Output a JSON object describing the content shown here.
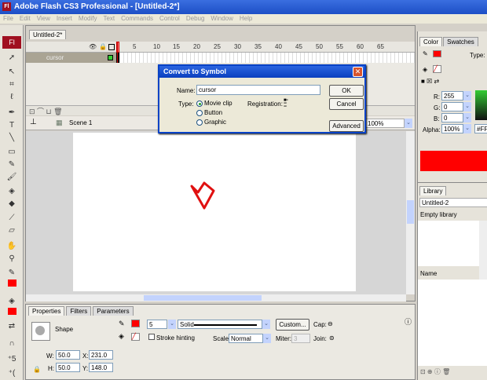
{
  "app": {
    "title": "Adobe Flash CS3 Professional - [Untitled-2*]",
    "logo": "Fl"
  },
  "menu": [
    "File",
    "Edit",
    "View",
    "Insert",
    "Modify",
    "Text",
    "Commands",
    "Control",
    "Debug",
    "Window",
    "Help"
  ],
  "document": {
    "tab": "Untitled-2*",
    "layer_name": "cursor",
    "frame_ticks": [
      "5",
      "10",
      "15",
      "20",
      "25",
      "30",
      "35",
      "40",
      "45",
      "50",
      "55",
      "60",
      "65"
    ],
    "scene": "Scene 1",
    "zoom": "100%"
  },
  "dialog": {
    "title": "Convert to Symbol",
    "name_label": "Name:",
    "name_value": "cursor",
    "type_label": "Type:",
    "types": [
      "Movie clip",
      "Button",
      "Graphic"
    ],
    "selected_type": "Movie clip",
    "registration_label": "Registration:",
    "ok": "OK",
    "cancel": "Cancel",
    "advanced": "Advanced"
  },
  "properties": {
    "tabs": [
      "Properties",
      "Filters",
      "Parameters"
    ],
    "object": "Shape",
    "stroke_height": "5",
    "stroke_style": "Solid",
    "custom": "Custom...",
    "cap_label": "Cap:",
    "stroke_hinting": "Stroke hinting",
    "scale_label": "Scale:",
    "scale_value": "Normal",
    "miter_label": "Miter:",
    "miter_value": "3",
    "join_label": "Join:",
    "w_label": "W:",
    "w": "50.0",
    "x_label": "X:",
    "x": "231.0",
    "h_label": "H:",
    "h": "50.0",
    "y_label": "Y:",
    "y": "148.0"
  },
  "color_panel": {
    "tabs": [
      "Color",
      "Swatches"
    ],
    "type_label": "Type:",
    "r_label": "R:",
    "r": "255",
    "g_label": "G:",
    "g": "0",
    "b_label": "B:",
    "b": "0",
    "alpha_label": "Alpha:",
    "alpha": "100%",
    "hex": "#FF",
    "color": "#ff0000"
  },
  "library": {
    "tab": "Library",
    "document": "Untitled-2",
    "status": "Empty library",
    "column": "Name"
  }
}
